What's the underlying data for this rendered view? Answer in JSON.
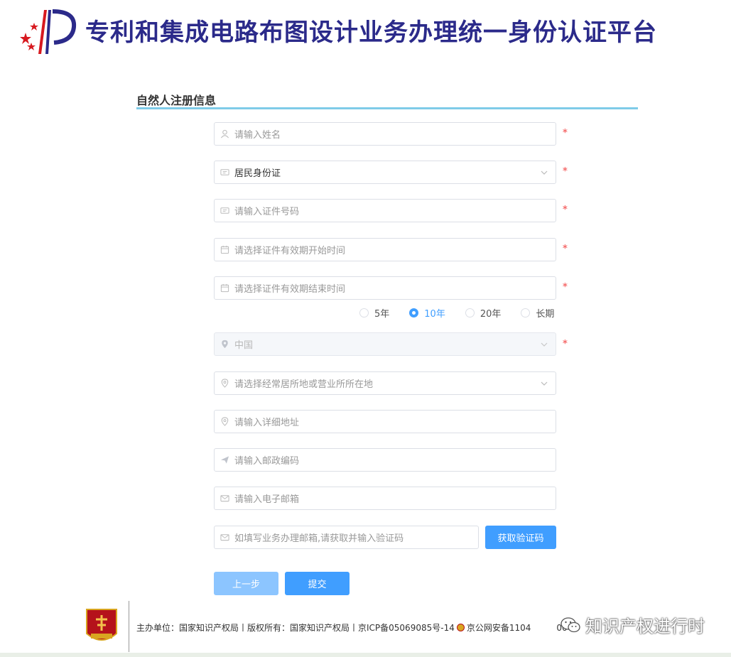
{
  "header": {
    "title": "专利和集成电路布图设计业务办理统一身份认证平台"
  },
  "section": {
    "title": "自然人注册信息"
  },
  "form": {
    "name_placeholder": "请输入姓名",
    "id_type_value": "居民身份证",
    "id_number_placeholder": "请输入证件号码",
    "valid_start_placeholder": "请选择证件有效期开始时间",
    "valid_end_placeholder": "请选择证件有效期结束时间",
    "validity_options": [
      "5年",
      "10年",
      "20年",
      "长期"
    ],
    "validity_selected": "10年",
    "country_value": "中国",
    "residence_placeholder": "请选择经常居所地或营业所所在地",
    "address_placeholder": "请输入详细地址",
    "postcode_placeholder": "请输入邮政编码",
    "email_placeholder": "请输入电子邮箱",
    "code_placeholder": "如填写业务办理邮箱,请获取并输入验证码",
    "required_mark": "*"
  },
  "buttons": {
    "get_code": "获取验证码",
    "prev": "上一步",
    "submit": "提交"
  },
  "footer": {
    "text_left": "主办单位：国家知识产权局丨版权所有：国家知识产权局丨京ICP备05069085号-14",
    "text_right": "京公网安备1104",
    "text_tail": "00号",
    "watermark": "知识产权进行时"
  },
  "colors": {
    "primary": "#409eff",
    "primary_light": "#8cc5ff",
    "title": "#2b2a8a",
    "required": "#f56c6c",
    "section_line": "#7fcbe8"
  }
}
